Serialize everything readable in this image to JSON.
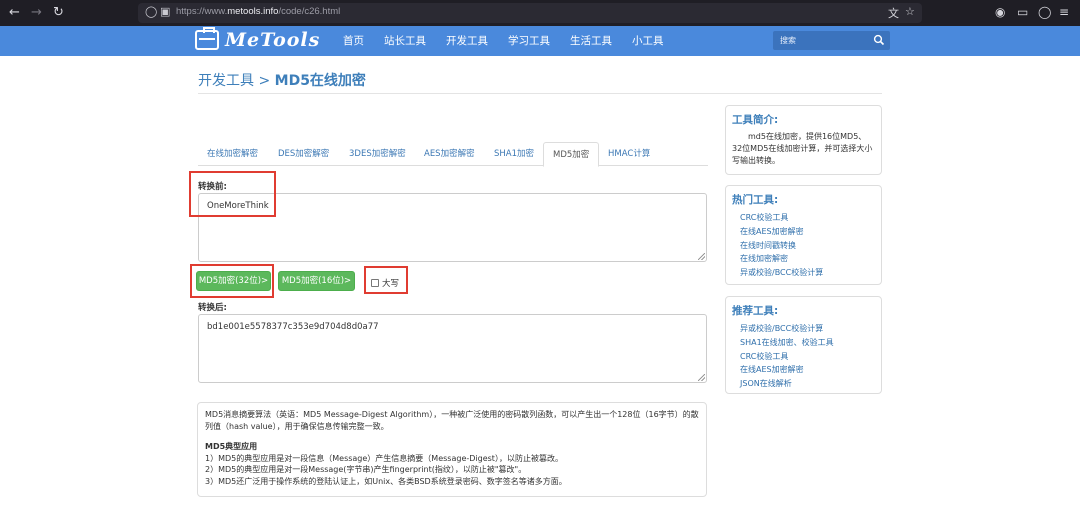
{
  "browser": {
    "url_prefix": "https://www.",
    "url_domain": "metools.info",
    "url_path": "/code/c26.html"
  },
  "site": {
    "logo_text": "MeTools",
    "menu": [
      "首页",
      "站长工具",
      "开发工具",
      "学习工具",
      "生活工具",
      "小工具"
    ],
    "search_placeholder": "搜索"
  },
  "page": {
    "breadcrumb_parent": "开发工具",
    "breadcrumb_sep": " > ",
    "breadcrumb_current": "MD5在线加密"
  },
  "tabs": [
    "在线加密解密",
    "DES加密解密",
    "3DES加密解密",
    "AES加密解密",
    "SHA1加密",
    "MD5加密",
    "HMAC计算"
  ],
  "active_tab": "MD5加密",
  "form": {
    "input_label": "转换前:",
    "input_value": "OneMoreThink",
    "btn32": "MD5加密(32位)>",
    "btn16": "MD5加密(16位)>",
    "uppercase_label": "大写",
    "uppercase_checked": false,
    "output_label": "转换后:",
    "output_value": "bd1e001e5578377c353e9d704d8d0a77"
  },
  "info": {
    "intro": "MD5消息摘要算法（英语：MD5 Message-Digest Algorithm），一种被广泛使用的密码散列函数，可以产生出一个128位（16字节）的散列值（hash value），用于确保信息传输完整一致。",
    "heading": "MD5典型应用",
    "items": [
      "1）MD5的典型应用是对一段信息（Message）产生信息摘要（Message-Digest），以防止被篡改。",
      "2）MD5的典型应用是对一段Message(字节串)产生fingerprint(指纹），以防止被\"篡改\"。",
      "3）MD5还广泛用于操作系统的登陆认证上，如Unix、各类BSD系统登录密码、数字签名等诸多方面。"
    ]
  },
  "sidebar": {
    "intro_title": "工具简介:",
    "intro_text": "md5在线加密，提供16位MD5、32位MD5在线加密计算，并可选择大小写输出转换。",
    "hot_title": "热门工具:",
    "hot_links": [
      "CRC校验工具",
      "在线AES加密解密",
      "在线时间戳转换",
      "在线加密解密",
      "异或校验/BCC校验计算"
    ],
    "rec_title": "推荐工具:",
    "rec_links": [
      "异或校验/BCC校验计算",
      "SHA1在线加密、校验工具",
      "CRC校验工具",
      "在线AES加密解密",
      "JSON在线解析"
    ]
  },
  "colors": {
    "header": "#4a89dc",
    "accent": "#3e7fba",
    "button": "#5cb85c",
    "highlight": "#e03c31"
  }
}
